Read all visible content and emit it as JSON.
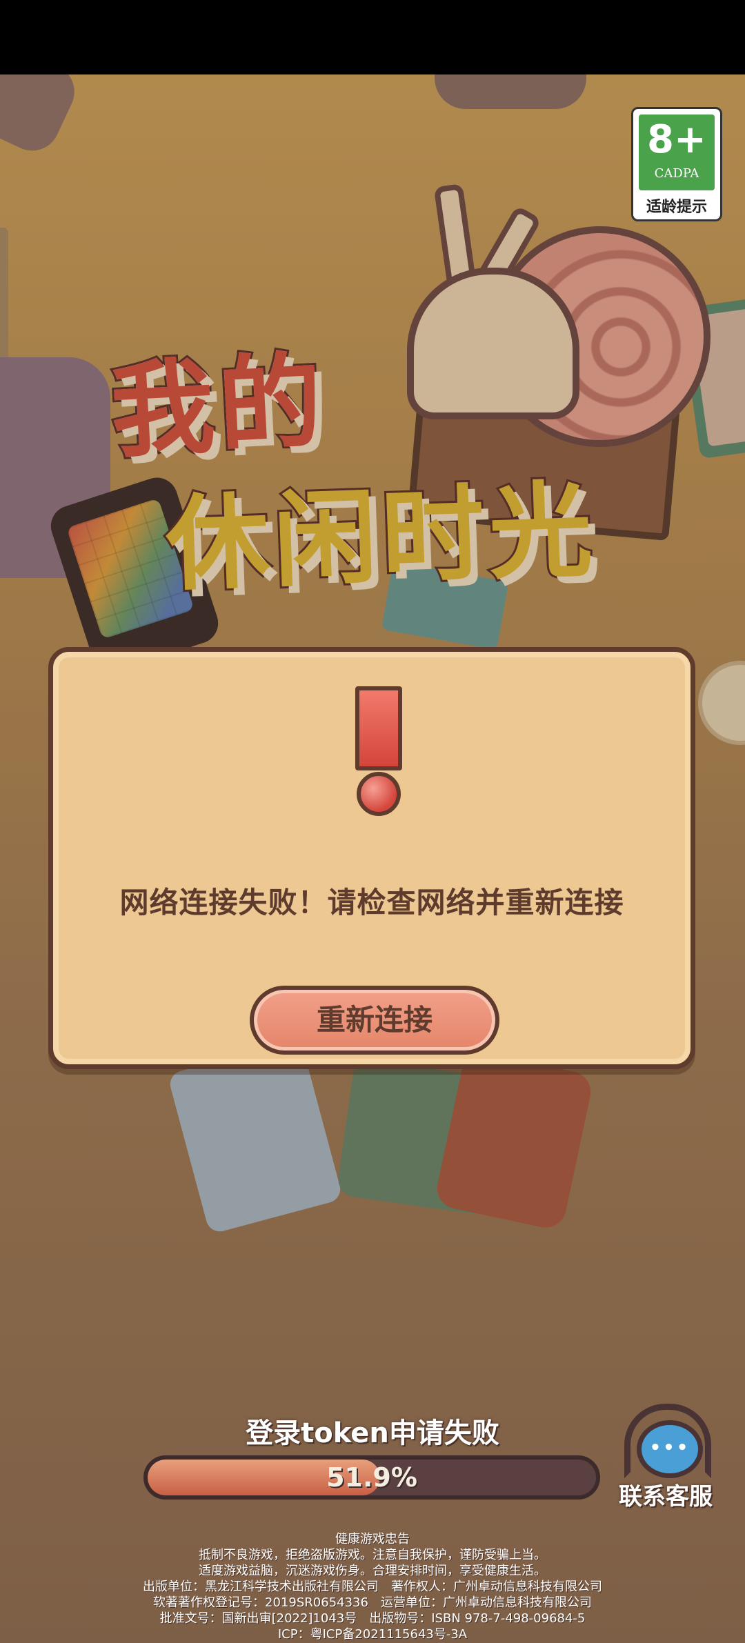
{
  "game": {
    "title_line1": "我的",
    "title_line2": "休闲时光"
  },
  "age_rating": {
    "number": "8+",
    "org": "CADPA",
    "caption": "适龄提示"
  },
  "dialog": {
    "message": "网络连接失败！请检查网络并重新连接",
    "button_label": "重新连接"
  },
  "loading": {
    "status_text": "登录token申请失败",
    "progress_label": "51.9%",
    "progress_fraction": 0.519
  },
  "support": {
    "label": "联系客服",
    "icon": "customer-service-headset-icon"
  },
  "footer": {
    "lines": [
      "健康游戏忠告",
      "抵制不良游戏，拒绝盗版游戏。注意自我保护，谨防受骗上当。",
      "适度游戏益脑，沉迷游戏伤身。合理安排时间，享受健康生活。",
      "出版单位：黑龙江科学技术出版社有限公司　著作权人：广州卓动信息科技有限公司",
      "软著著作权登记号：2019SR0654336　运营单位：广州卓动信息科技有限公司",
      "批准文号：国新出审[2022]1043号　出版物号：ISBN 978-7-498-09684-5",
      "ICP：粤ICP备2021115643号-3A"
    ]
  },
  "colors": {
    "background": "#b78d53",
    "dialog_bg": "#edc893",
    "dialog_border": "#5e3b2c",
    "button_bg": "#e58569",
    "progress_fill": "#c95f45",
    "rating_green": "#4aa34b"
  }
}
